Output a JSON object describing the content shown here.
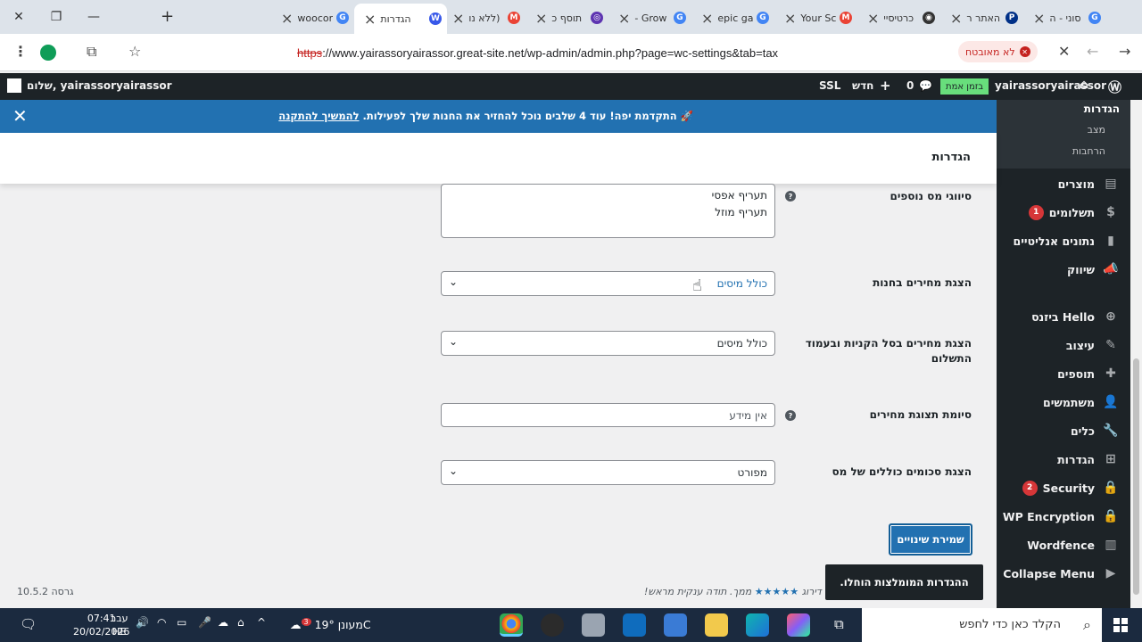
{
  "browser": {
    "tabs": [
      {
        "title": "סוני - ה",
        "favicon": "G",
        "color": "#4285f4"
      },
      {
        "title": "האתר ר",
        "favicon": "P",
        "color": "#003087"
      },
      {
        "title": "כרטיסיי",
        "favicon": "◉",
        "color": "#333333"
      },
      {
        "title": "Your Sc",
        "favicon": "M",
        "color": "#ea4335"
      },
      {
        "title": "epic ga",
        "favicon": "G",
        "color": "#4285f4"
      },
      {
        "title": "Grow -",
        "favicon": "G",
        "color": "#4285f4"
      },
      {
        "title": "תוסף כ",
        "favicon": "◎",
        "color": "#5e35b1"
      },
      {
        "title": "(ללא נו",
        "favicon": "M",
        "color": "#ea4335"
      },
      {
        "title": "הגדרות",
        "favicon": "W",
        "color": "#3858e9"
      },
      {
        "title": "woocor",
        "favicon": "G",
        "color": "#4285f4"
      }
    ],
    "url_scheme": "https",
    "url_rest": "://www.yairassoryairassor.great-site.net/wp-admin/admin.php?page=wc-settings&tab=tax",
    "not_secure": "לא מאובטח"
  },
  "adminbar": {
    "site": "yairassoryairassor",
    "live": "בזמן אמת",
    "comments": "0",
    "new": "חדש",
    "ssl": "SSL",
    "greeting": "שלום, yairassoryairassor"
  },
  "sidebar": {
    "submenu_head": "הגדרות",
    "submenu": [
      "מצב",
      "הרחבות"
    ],
    "items": [
      {
        "label": "מוצרים",
        "icon": "▤",
        "badge": ""
      },
      {
        "label": "תשלומים",
        "icon": "$",
        "badge": "1"
      },
      {
        "label": "נתונים אנליטיים",
        "icon": "▮",
        "badge": ""
      },
      {
        "label": "שיווק",
        "icon": "📣",
        "badge": ""
      }
    ],
    "items2": [
      {
        "label": "Hello ביזנס",
        "icon": "⊕",
        "badge": ""
      },
      {
        "label": "עיצוב",
        "icon": "✎",
        "badge": ""
      },
      {
        "label": "תוספים",
        "icon": "✚",
        "badge": ""
      },
      {
        "label": "משתמשים",
        "icon": "👤",
        "badge": ""
      },
      {
        "label": "כלים",
        "icon": "🔧",
        "badge": ""
      },
      {
        "label": "הגדרות",
        "icon": "⊞",
        "badge": ""
      },
      {
        "label": "Security",
        "icon": "🔒",
        "badge": "2"
      },
      {
        "label": "WP Encryption",
        "icon": "🔒",
        "badge": ""
      },
      {
        "label": "Wordfence",
        "icon": "▥",
        "badge": ""
      },
      {
        "label": "Collapse Menu",
        "icon": "▶",
        "badge": ""
      }
    ]
  },
  "notice": {
    "text": "התקדמת יפה! עוד ",
    "bold": "4 שלבים",
    "text2": " נוכל להחזיר את החנות שלך לפעילות. ",
    "link": "להמשיך להתקנה"
  },
  "page_title": "הגדרות",
  "form": {
    "tax_classes_label": "סיווגי מס נוספים",
    "tax_classes_value": "תעריף אפסי\nתעריף מוזל",
    "shop_prices_label": "הצגת מחירים בחנות",
    "shop_prices_value": "כולל מיסים",
    "cart_prices_label": "הצגת מחירים בסל הקניות ובעמוד התשלום",
    "cart_prices_value": "כולל מיסים",
    "price_suffix_label": "סיומת תצוגת מחירים",
    "price_suffix_placeholder": "אין מידע",
    "tax_totals_label": "הצגת סכומים כוללים של מס",
    "tax_totals_value": "מפורט"
  },
  "save_button": "שמירת שינויים",
  "toast": "ההגדרות המומלצות הוחלו.",
  "footer": {
    "rate_text": "ממך. תודה ענקית מראש!",
    "stars": "★★★★★",
    "rate_prefix": "דירוג",
    "version": "גרסה 10.5.2"
  },
  "taskbar": {
    "search_placeholder": "הקלד כאן כדי לחפש",
    "weather": "מעונן 19°C",
    "weather_badge": "3",
    "time": "07:41",
    "date": "20/02/2026",
    "lang_top": "עבר",
    "lang_bottom": "HE"
  }
}
